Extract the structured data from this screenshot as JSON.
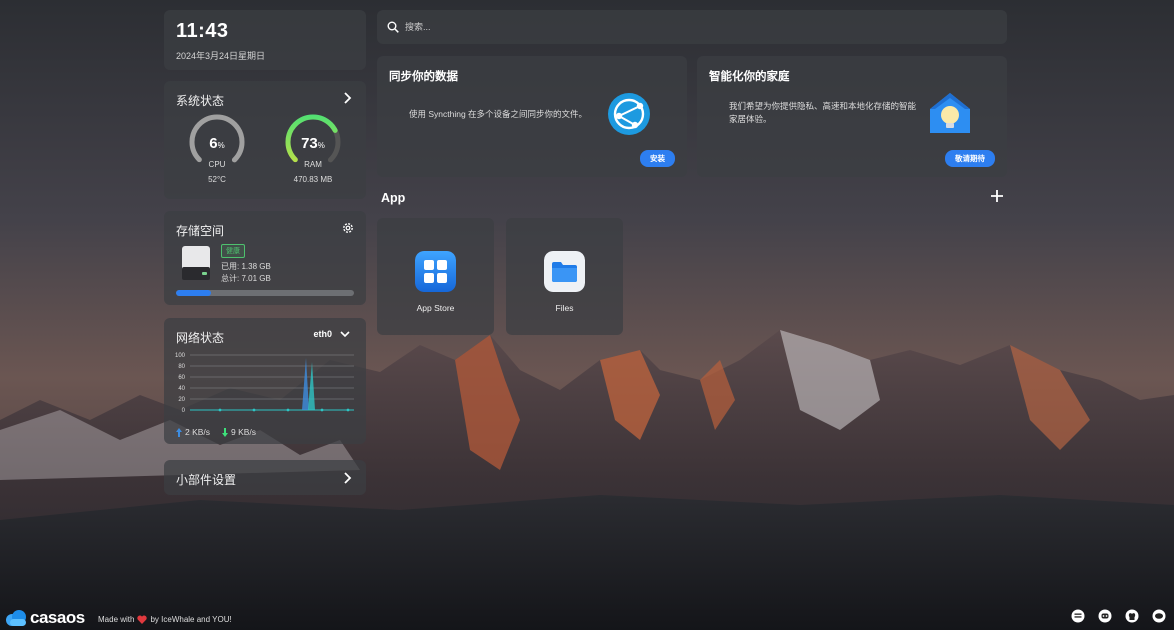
{
  "clock": {
    "time": "11:43",
    "date": "2024年3月24日星期日"
  },
  "system_status": {
    "title": "系统状态",
    "cpu": {
      "value": "6",
      "unit": "%",
      "label": "CPU",
      "sub": "52°C",
      "percent": 6
    },
    "ram": {
      "value": "73",
      "unit": "%",
      "label": "RAM",
      "sub": "470.83 MB",
      "percent": 73
    }
  },
  "storage": {
    "title": "存储空间",
    "badge": "健康",
    "used": "已用: 1.38 GB",
    "total": "总计: 7.01 GB",
    "used_fraction": 0.197
  },
  "network": {
    "title": "网络状态",
    "interface": "eth0",
    "chart_y_ticks": [
      "100",
      "80",
      "60",
      "40",
      "20",
      "0"
    ],
    "upload": "2 KB/s",
    "download": "9 KB/s"
  },
  "widget_settings": {
    "title": "小部件设置"
  },
  "search": {
    "placeholder": "搜索..."
  },
  "cards": {
    "sync": {
      "title": "同步你的数据",
      "desc": "使用 Syncthing 在多个设备之间同步你的文件。",
      "button": "安装"
    },
    "home": {
      "title": "智能化你的家庭",
      "desc": "我们希望为你提供隐私、高速和本地化存储的智能家居体验。",
      "button": "敬请期待"
    }
  },
  "apps": {
    "title": "App",
    "items": [
      {
        "name": "App Store",
        "icon": "app-store-icon"
      },
      {
        "name": "Files",
        "icon": "folder-icon"
      }
    ]
  },
  "footer": {
    "brand": "casaos",
    "made_prefix": "Made with",
    "made_suffix": "by IceWhale and YOU!",
    "icons": [
      "message-icon",
      "discord-icon",
      "github-icon",
      "chat-icon"
    ]
  },
  "colors": {
    "accent": "#2d7ef0",
    "healthy": "#4ec16e",
    "cpu_gauge": "#9a9a9a",
    "ram_gauge_start": "#3ee07a",
    "ram_gauge_end": "#d8e03c"
  }
}
